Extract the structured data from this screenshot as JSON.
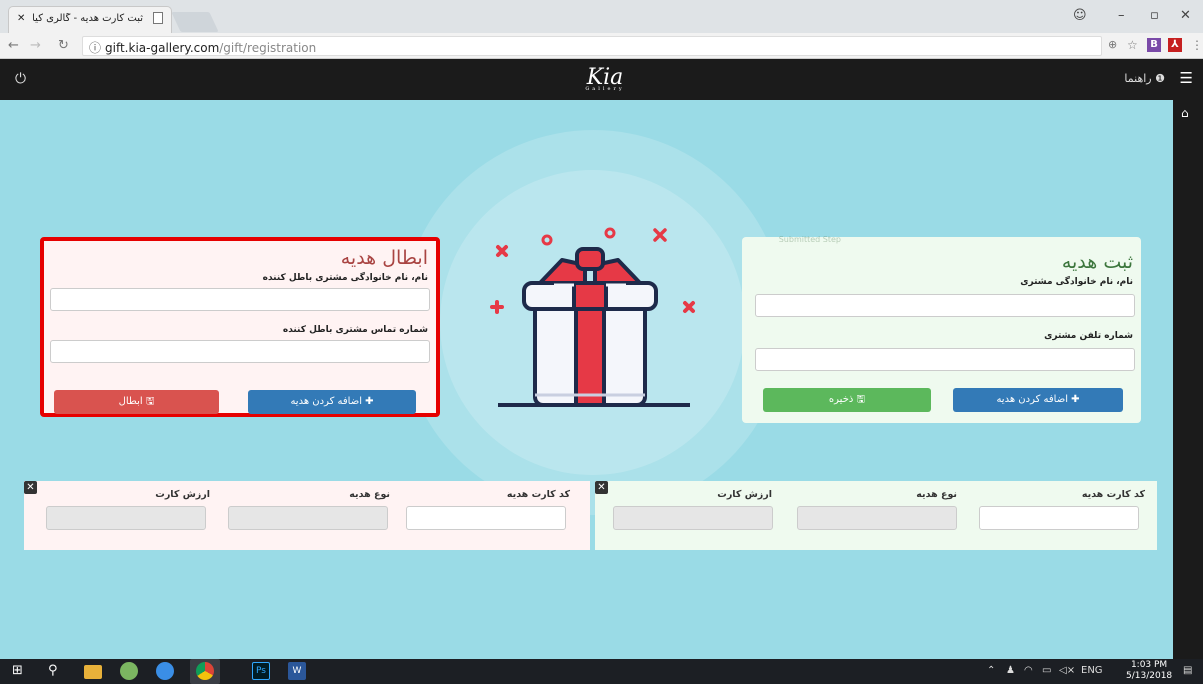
{
  "browser": {
    "tab_title": "ثبت کارت هدیه - گالری کیا",
    "url_host": "gift.kia-gallery.com",
    "url_path": "/gift/registration"
  },
  "header": {
    "logo": "Kia",
    "logo_sub": "Gallery",
    "help_label": "راهنما"
  },
  "cancel_form": {
    "title": "ابطال هدیه",
    "name_label": "نام، نام خانوادگی مشتری باطل کننده",
    "phone_label": "شماره تماس مشتری باطل کننده",
    "add_button": "اضافه کردن هدیه",
    "cancel_button": "ابطال"
  },
  "register_form": {
    "title": "ثبت هدیه",
    "faded_text": "Submitted Step",
    "name_label": "نام، نام خانوادگی مشتری",
    "phone_label": "شماره تلفن مشتری",
    "add_button": "اضافه کردن هدیه",
    "save_button": "ذخیره"
  },
  "line_columns": {
    "card_code": "کد کارت هدیه",
    "gift_type": "نوع هدیه",
    "card_value": "ارزش کارت"
  },
  "taskbar": {
    "lang": "ENG",
    "time": "1:03 PM",
    "date": "5/13/2018"
  }
}
